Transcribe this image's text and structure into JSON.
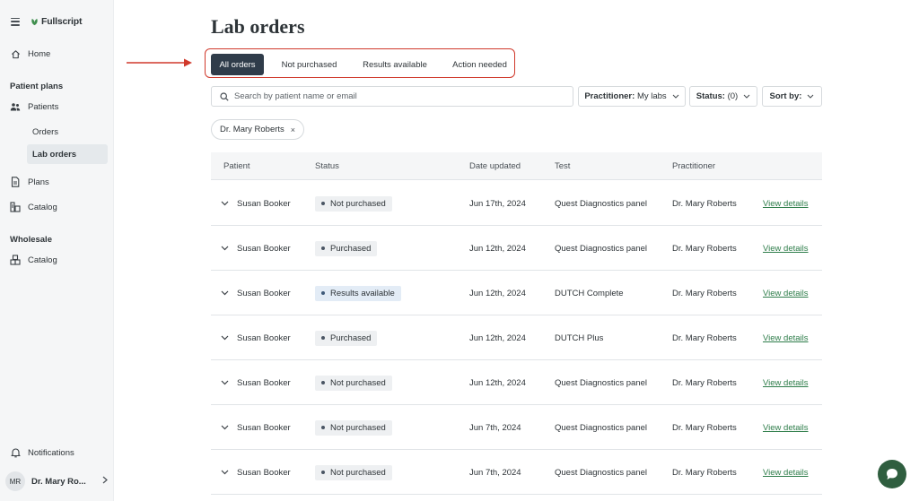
{
  "app": {
    "brand": "Fullscript"
  },
  "colors": {
    "accent": "#2f3c4a",
    "link": "#2e7d4a",
    "highlight_box": "#d0392b",
    "chat": "#2f5e3f"
  },
  "sidebar": {
    "home": "Home",
    "section_patient_plans": "Patient plans",
    "patients": "Patients",
    "orders": "Orders",
    "lab_orders": "Lab orders",
    "plans": "Plans",
    "catalog": "Catalog",
    "section_wholesale": "Wholesale",
    "wholesale_catalog": "Catalog",
    "notifications": "Notifications",
    "user_initials": "MR",
    "user_name": "Dr. Mary Ro..."
  },
  "page": {
    "title": "Lab orders"
  },
  "tabs": [
    {
      "label": "All orders",
      "active": true
    },
    {
      "label": "Not purchased",
      "active": false
    },
    {
      "label": "Results available",
      "active": false
    },
    {
      "label": "Action needed",
      "active": false
    }
  ],
  "filters": {
    "search_placeholder": "Search by patient name or email",
    "practitioner_label": "Practitioner:",
    "practitioner_value": "My labs",
    "status_label": "Status:",
    "status_value": "(0)",
    "sort_label": "Sort by:",
    "active_chip": "Dr. Mary Roberts"
  },
  "table": {
    "columns": [
      "Patient",
      "Status",
      "Date updated",
      "Test",
      "Practitioner"
    ],
    "rows": [
      {
        "patient": "Susan Booker",
        "status": "Not purchased",
        "date": "Jun 17th, 2024",
        "test": "Quest Diagnostics panel",
        "practitioner": "Dr. Mary Roberts",
        "action": "View details"
      },
      {
        "patient": "Susan Booker",
        "status": "Purchased",
        "date": "Jun 12th, 2024",
        "test": "Quest Diagnostics panel",
        "practitioner": "Dr. Mary Roberts",
        "action": "View details"
      },
      {
        "patient": "Susan Booker",
        "status": "Results available",
        "date": "Jun 12th, 2024",
        "test": "DUTCH Complete",
        "practitioner": "Dr. Mary Roberts",
        "action": "View details"
      },
      {
        "patient": "Susan Booker",
        "status": "Purchased",
        "date": "Jun 12th, 2024",
        "test": "DUTCH Plus",
        "practitioner": "Dr. Mary Roberts",
        "action": "View details"
      },
      {
        "patient": "Susan Booker",
        "status": "Not purchased",
        "date": "Jun 12th, 2024",
        "test": "Quest Diagnostics panel",
        "practitioner": "Dr. Mary Roberts",
        "action": "View details"
      },
      {
        "patient": "Susan Booker",
        "status": "Not purchased",
        "date": "Jun 7th, 2024",
        "test": "Quest Diagnostics panel",
        "practitioner": "Dr. Mary Roberts",
        "action": "View details"
      },
      {
        "patient": "Susan Booker",
        "status": "Not purchased",
        "date": "Jun 7th, 2024",
        "test": "Quest Diagnostics panel",
        "practitioner": "Dr. Mary Roberts",
        "action": "View details"
      }
    ]
  }
}
